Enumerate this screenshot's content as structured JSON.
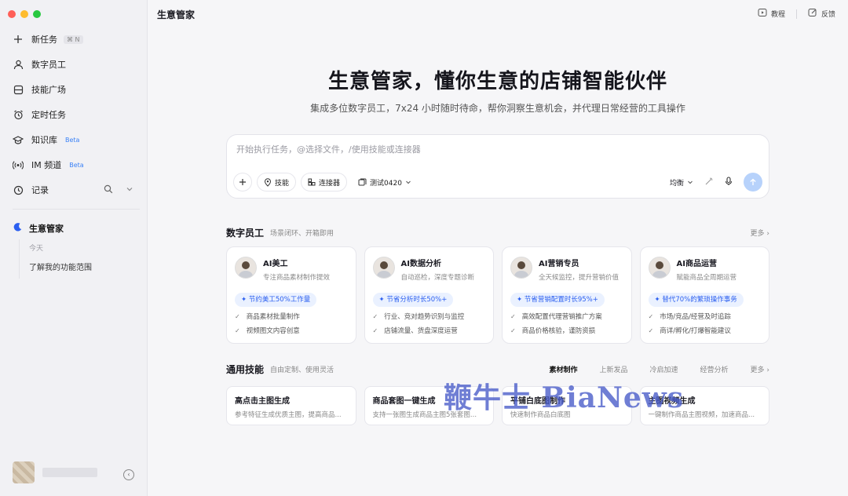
{
  "window": {
    "traffic_colors": [
      "#ff5f57",
      "#febc2e",
      "#28c840"
    ]
  },
  "sidebar": {
    "new_task": {
      "label": "新任务",
      "shortcut": "⌘ N"
    },
    "items": [
      {
        "label": "数字员工",
        "icon": "person-icon"
      },
      {
        "label": "技能广场",
        "icon": "grid-icon"
      },
      {
        "label": "定时任务",
        "icon": "alarm-icon"
      },
      {
        "label": "知识库",
        "icon": "graduation-cap-icon",
        "badge": "Beta"
      },
      {
        "label": "IM 频道",
        "icon": "radio-icon",
        "badge": "Beta"
      },
      {
        "label": "记录",
        "icon": "clock-icon"
      }
    ],
    "session": {
      "title": "生意管家",
      "date": "今天",
      "items": [
        "了解我的功能范围"
      ]
    }
  },
  "header": {
    "title": "生意管家",
    "tutorial": "教程",
    "feedback": "反馈"
  },
  "hero": {
    "title": "生意管家，懂你生意的店铺智能伙伴",
    "subtitle": "集成多位数字员工，7x24 小时随时待命，帮你洞察生意机会，并代理日常经营的工具操作"
  },
  "composer": {
    "placeholder": "开始执行任务，@选择文件，/使用技能或连接器",
    "skill_label": "技能",
    "connector_label": "连接器",
    "project_label": "测试0420",
    "mode_label": "均衡"
  },
  "digital_staff": {
    "title": "数字员工",
    "desc": "场景闭环、开箱即用",
    "more": "更多",
    "cards": [
      {
        "name": "AI美工",
        "desc": "专注商品素材制作提效",
        "badge": "节约美工50%工作量",
        "features": [
          "商品素材批量制作",
          "视频图文内容创意"
        ]
      },
      {
        "name": "AI数据分析",
        "desc": "自动巡检，深度专题诊断",
        "badge": "节省分析时长50%+",
        "features": [
          "行业、竞对趋势识别与监控",
          "店铺流量、货盘深度运营"
        ]
      },
      {
        "name": "AI营销专员",
        "desc": "全天候监控，提升营销价值",
        "badge": "节省营销配置时长95%+",
        "features": [
          "高效配置代理营销推广方案",
          "商品价格核验，谨防资损"
        ]
      },
      {
        "name": "AI商品运营",
        "desc": "赋能商品全周期运营",
        "badge": "替代70%的繁琐操作事务",
        "features": [
          "市场/竞品/经营及时追踪",
          "商详/孵化/打爆智能建议"
        ]
      }
    ]
  },
  "general_skills": {
    "title": "通用技能",
    "desc": "自由定制、使用灵活",
    "tabs": [
      "素材制作",
      "上新发品",
      "冷启加速",
      "经营分析"
    ],
    "active_tab": "素材制作",
    "more": "更多",
    "cards": [
      {
        "title": "高点击主图生成",
        "desc": "参考特征生成优质主图，提高商品..."
      },
      {
        "title": "商品套图一键生成",
        "desc": "支持一张图生成商品主图5张套图..."
      },
      {
        "title": "平铺白底图制作",
        "desc": "快速制作商品白底图"
      },
      {
        "title": "主图视频生成",
        "desc": "一键制作商品主图视频，加速商品..."
      }
    ]
  },
  "watermark": "鞭牛士 BiaNews"
}
